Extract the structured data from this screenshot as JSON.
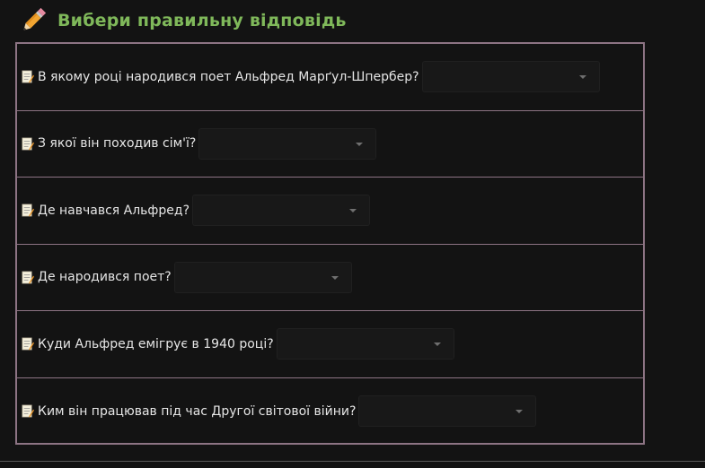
{
  "heading": {
    "title": "Вибери правильну відповідь",
    "icon": "pencil-icon"
  },
  "questions": [
    {
      "text": "В якому році народився поет Альфред Марґул-Шпербер?",
      "selected": ""
    },
    {
      "text": "З якої він походив сім'ї?",
      "selected": ""
    },
    {
      "text": "Де навчався Альфред?",
      "selected": ""
    },
    {
      "text": "Де народився поет?",
      "selected": ""
    },
    {
      "text": "Куди Альфред емігрує в 1940 році?",
      "selected": ""
    },
    {
      "text": "Ким він працював під час Другої світової війни?",
      "selected": ""
    }
  ],
  "colors": {
    "background": "#131313",
    "heading": "#7fb85a",
    "border": "#8d7484",
    "text": "#e6e6e6"
  }
}
